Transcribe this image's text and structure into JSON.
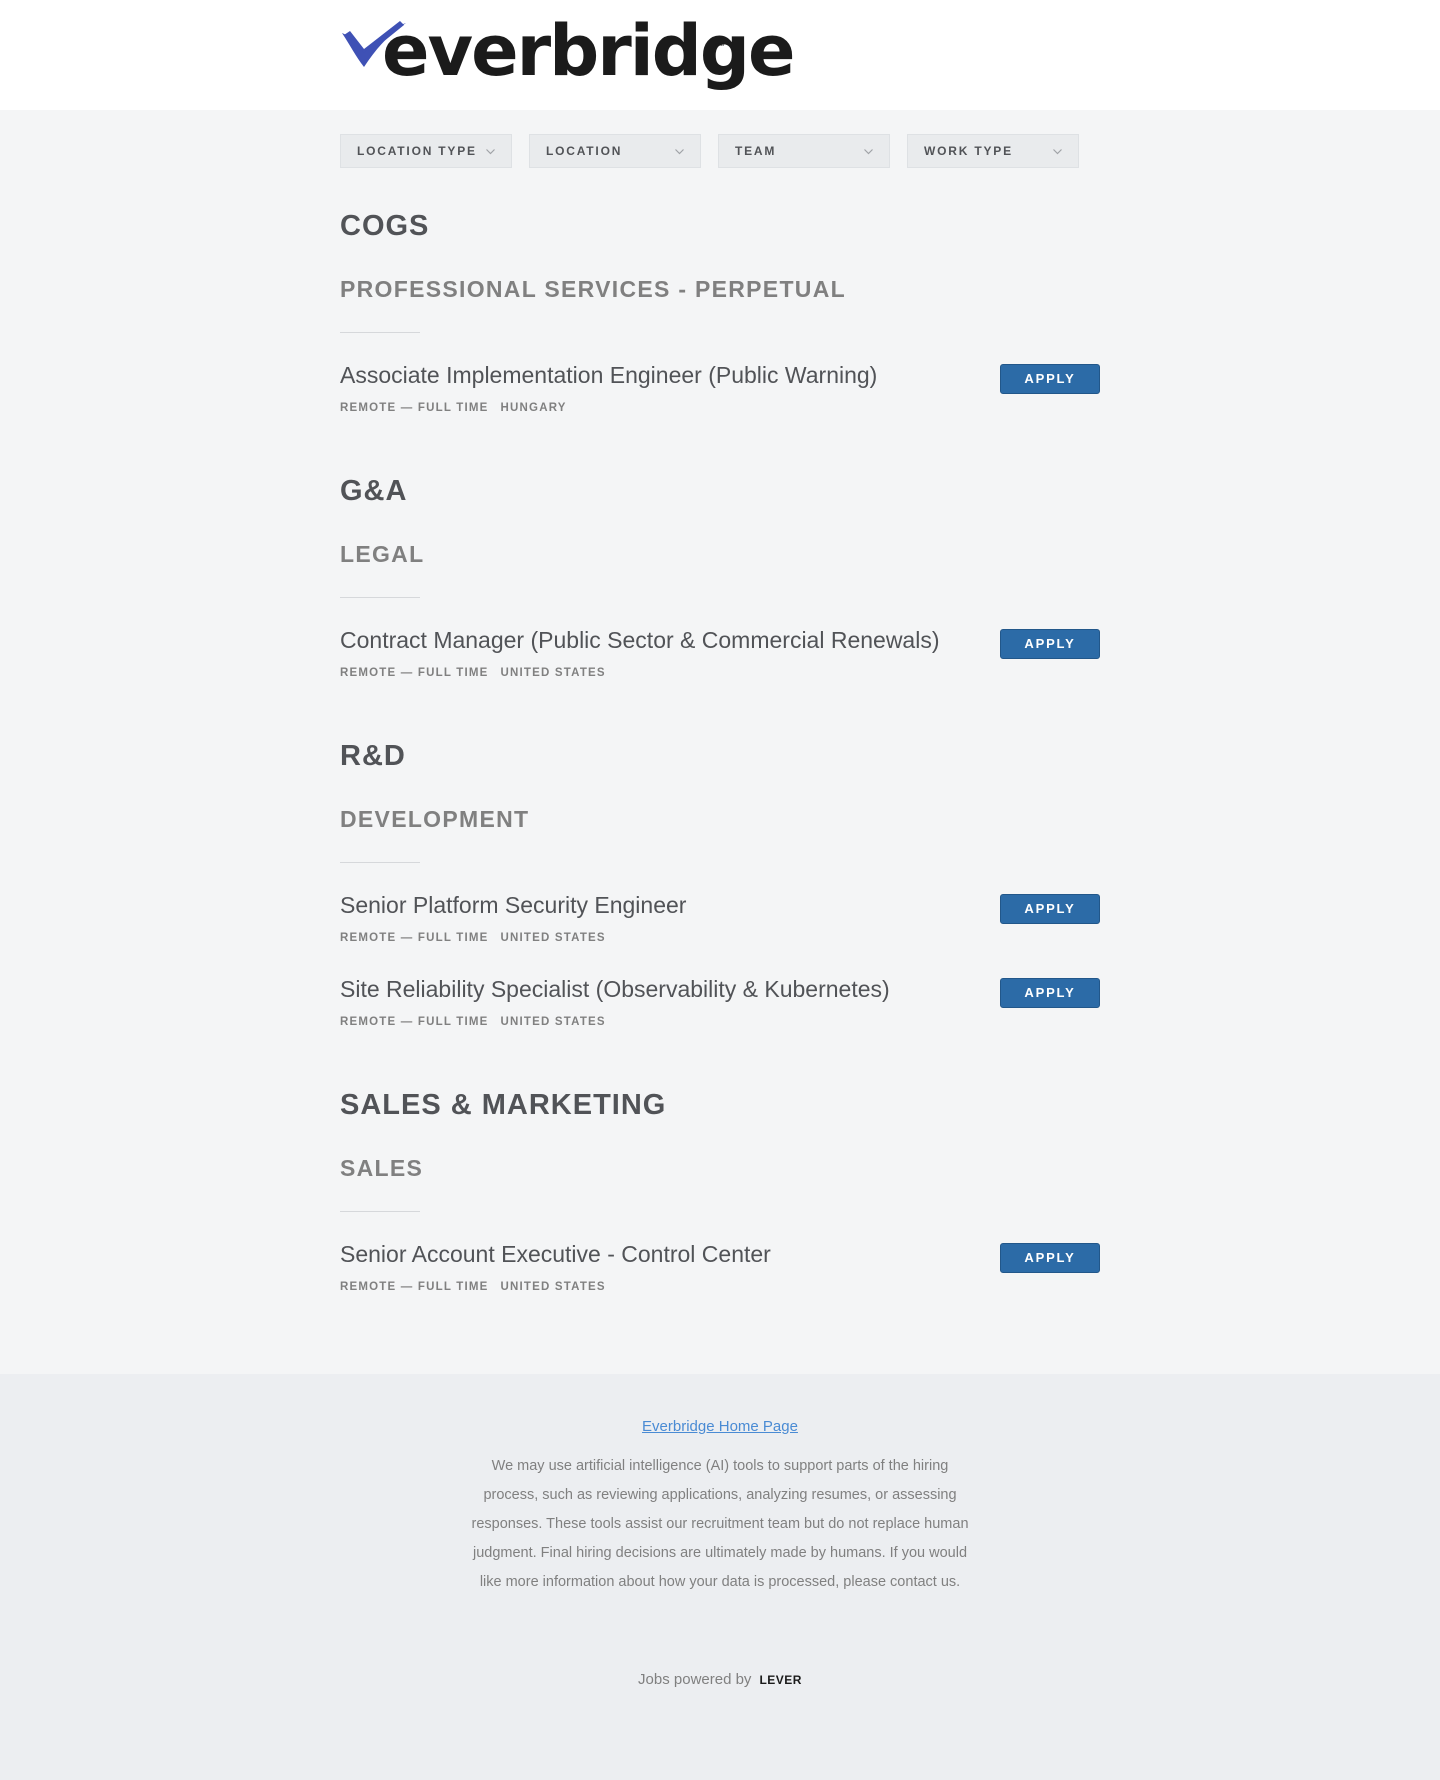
{
  "header": {
    "logo_text": "everbridge",
    "logo_tm": "™",
    "brand_color": "#3f51b5"
  },
  "filters": [
    {
      "label": "LOCATION TYPE"
    },
    {
      "label": "LOCATION"
    },
    {
      "label": "TEAM"
    },
    {
      "label": "WORK TYPE"
    }
  ],
  "groups": [
    {
      "department": "COGS",
      "team": "PROFESSIONAL SERVICES - PERPETUAL",
      "postings": [
        {
          "title": "Associate Implementation Engineer (Public Warning)",
          "commitment": "REMOTE — FULL TIME",
          "location": "HUNGARY",
          "apply_label": "APPLY"
        }
      ]
    },
    {
      "department": "G&A",
      "team": "LEGAL",
      "postings": [
        {
          "title": "Contract Manager (Public Sector & Commercial Renewals)",
          "commitment": "REMOTE — FULL TIME",
          "location": "UNITED STATES",
          "apply_label": "APPLY"
        }
      ]
    },
    {
      "department": "R&D",
      "team": "DEVELOPMENT",
      "postings": [
        {
          "title": "Senior Platform Security Engineer",
          "commitment": "REMOTE — FULL TIME",
          "location": "UNITED STATES",
          "apply_label": "APPLY"
        },
        {
          "title": "Site Reliability Specialist (Observability & Kubernetes)",
          "commitment": "REMOTE — FULL TIME",
          "location": "UNITED STATES",
          "apply_label": "APPLY"
        }
      ]
    },
    {
      "department": "SALES & MARKETING",
      "team": "SALES",
      "postings": [
        {
          "title": "Senior Account Executive - Control Center",
          "commitment": "REMOTE — FULL TIME",
          "location": "UNITED STATES",
          "apply_label": "APPLY"
        }
      ]
    }
  ],
  "footer": {
    "home_link": "Everbridge Home Page",
    "disclaimer": "We may use artificial intelligence (AI) tools to support parts of the hiring process, such as reviewing applications, analyzing resumes, or assessing responses. These tools assist our recruitment team but do not replace human judgment. Final hiring decisions are ultimately made by humans. If you would like more information about how your data is processed, please contact us.",
    "powered_by": "Jobs powered by",
    "lever_logo": "LEVER"
  }
}
